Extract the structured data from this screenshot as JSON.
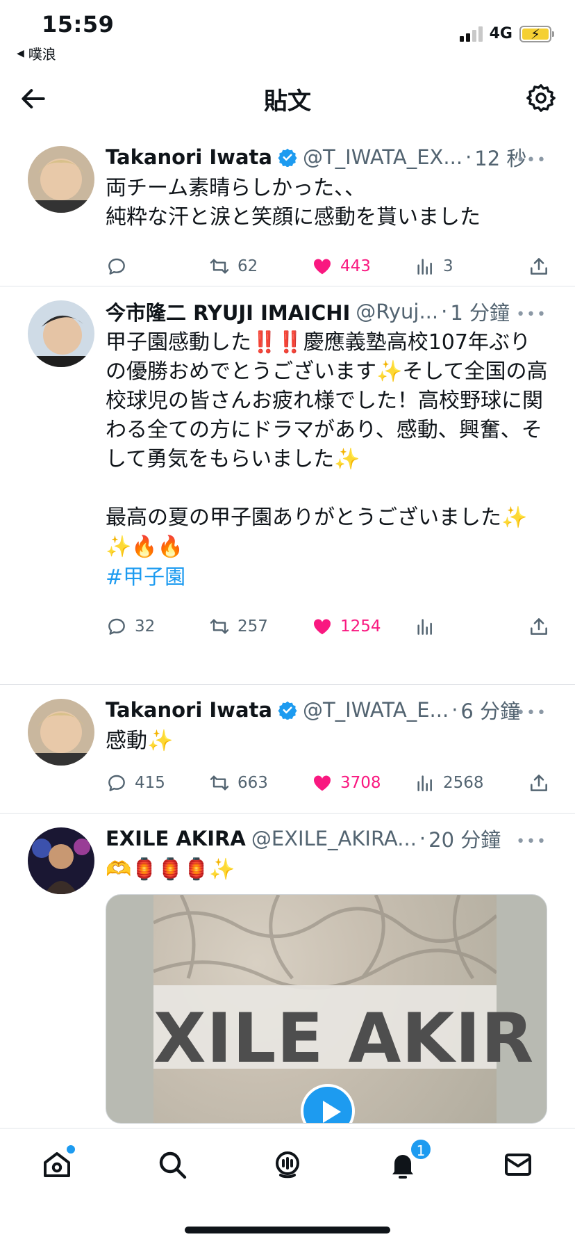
{
  "status_bar": {
    "time": "15:59",
    "back_app": "噗浪",
    "network": "4G"
  },
  "header": {
    "title": "貼文"
  },
  "posts": [
    {
      "name": "Takanori Iwata",
      "verified": true,
      "handle": "@T_IWATA_EX...",
      "ago": "12 秒",
      "text": "両チーム素晴らしかった、、\n純粋な汗と涙と笑顔に感動を貰いました",
      "replies": "",
      "retweets": "62",
      "likes": "443",
      "views": "3"
    },
    {
      "name": "今市隆二 RYUJI IMAICHI",
      "verified": false,
      "handle": "@Ryuj...",
      "ago": "1 分鐘",
      "text": "甲子園感動した‼️‼️慶應義塾高校107年ぶりの優勝おめでとうございます✨そして全国の高校球児の皆さんお疲れ様でした！高校野球に関わる全ての方にドラマがあり、感動、興奮、そして勇気をもらいました✨\n\n最高の夏の甲子園ありがとうございました✨✨🔥🔥\n",
      "hashtag": "#甲子園",
      "replies": "32",
      "retweets": "257",
      "likes": "1254",
      "views": ""
    },
    {
      "name": "Takanori Iwata",
      "verified": true,
      "handle": "@T_IWATA_E...",
      "ago": "6 分鐘",
      "text": "感動✨",
      "replies": "415",
      "retweets": "663",
      "likes": "3708",
      "views": "2568"
    },
    {
      "name": "EXILE AKIRA",
      "verified": false,
      "handle": "@EXILE_AKIRA...",
      "ago": "20 分鐘",
      "text": "🫶🏮🏮🏮✨",
      "media_text": "XILE AKIR"
    }
  ],
  "tabbar": {
    "notifications_badge": "1"
  },
  "colors": {
    "accent": "#1d9bf0",
    "like": "#f91880",
    "muted": "#536471"
  }
}
